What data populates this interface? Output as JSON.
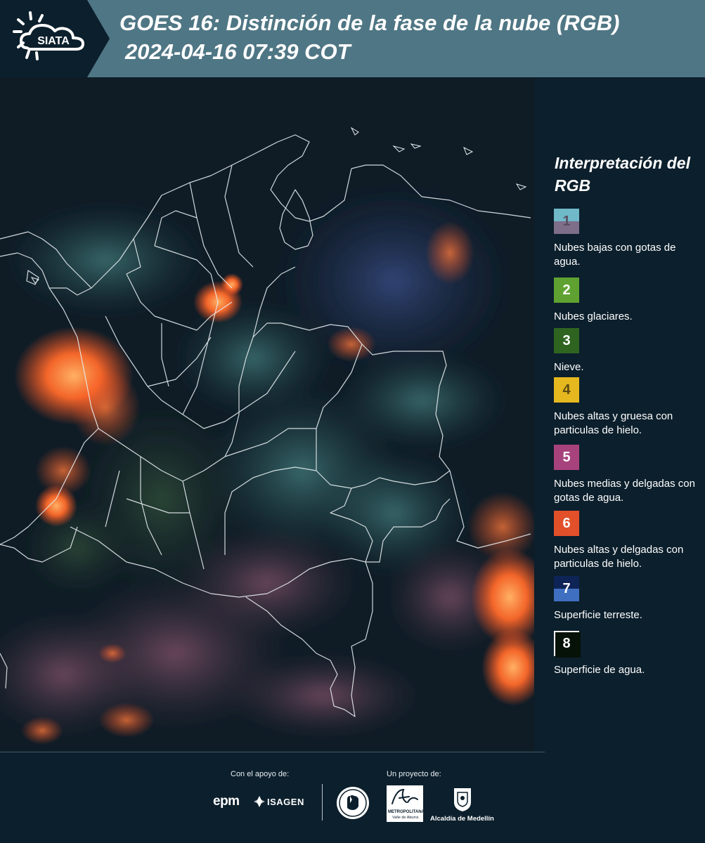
{
  "header": {
    "logo_text": "SIATA",
    "title": "GOES 16: Distinción de la fase de la nube (RGB)",
    "subtitle": "2024-04-16 07:39 COT",
    "colors": {
      "bar": "#4f7684",
      "logo_panel": "#0c1f2c"
    }
  },
  "map": {
    "description_icon": "satellite-rgb-map",
    "background": "#0e1a24"
  },
  "legend": {
    "title": "Interpretación del RGB",
    "items": [
      {
        "number": "1",
        "label": "Nubes bajas con gotas de agua.",
        "color_top": "#6fb9c8",
        "color_bottom": "#7e6e8a",
        "num_color": "#5a4f62"
      },
      {
        "number": "2",
        "label": "Nubes glaciares.",
        "color_top": "#5fa231",
        "color_bottom": "#5fa231",
        "num_color": "#ffffff"
      },
      {
        "number": "3",
        "label": "Nieve.",
        "color_top": "#2f6420",
        "color_bottom": "#2f6420",
        "num_color": "#ffffff"
      },
      {
        "number": "4",
        "label": "Nubes altas y gruesa con particulas de hielo.",
        "color_top": "#e6b81f",
        "color_bottom": "#e6b81f",
        "num_color": "#5a4a12"
      },
      {
        "number": "5",
        "label": "Nubes medias y delgadas con gotas de agua.",
        "color_top": "#a8427d",
        "color_bottom": "#a8427d",
        "num_color": "#ffffff"
      },
      {
        "number": "6",
        "label": "Nubes altas y delgadas con particulas de hielo.",
        "color_top": "#e2502a",
        "color_bottom": "#e2502a",
        "num_color": "#ffffff"
      },
      {
        "number": "7",
        "label": "Superficie terreste.",
        "color_top": "#0e2457",
        "color_bottom": "#3f6fc1",
        "num_color": "#ffffff"
      },
      {
        "number": "8",
        "label": "Superficie de agua.",
        "color_top": "#061208",
        "color_bottom": "#061208",
        "num_color": "#ffffff"
      }
    ]
  },
  "footer": {
    "support_caption": "Con el apoyo de:",
    "project_caption": "Un proyecto de:",
    "sponsors": {
      "epm": "epm",
      "isagen": "ISAGEN",
      "area_line1": "METROPOLITANA",
      "area_line2": "Valle de Aburrá",
      "alcaldia": "Alcaldía de Medellín"
    }
  }
}
